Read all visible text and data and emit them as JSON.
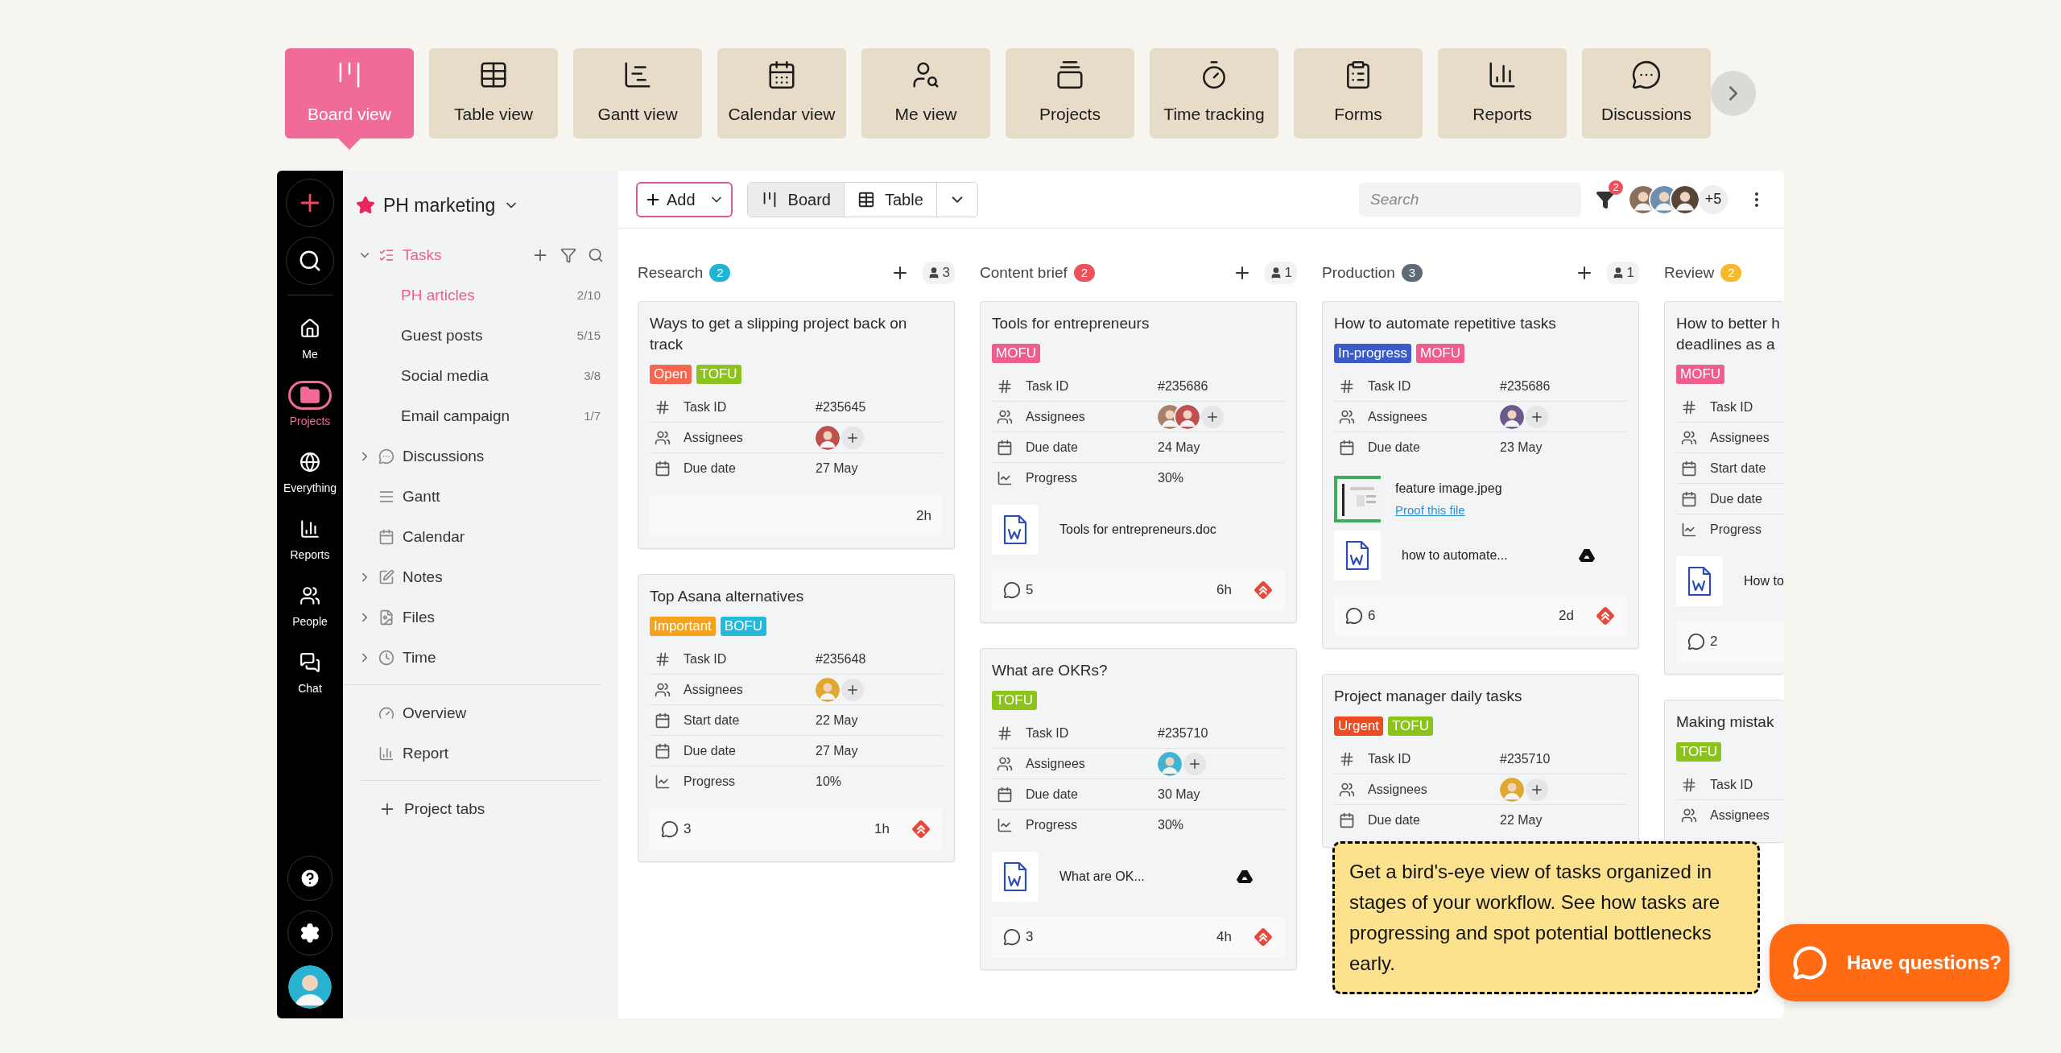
{
  "top_tabs": [
    {
      "label": "Board view",
      "selected": true
    },
    {
      "label": "Table view",
      "selected": false
    },
    {
      "label": "Gantt view",
      "selected": false
    },
    {
      "label": "Calendar view",
      "selected": false
    },
    {
      "label": "Me view",
      "selected": false
    },
    {
      "label": "Projects",
      "selected": false
    },
    {
      "label": "Time tracking",
      "selected": false
    },
    {
      "label": "Forms",
      "selected": false
    },
    {
      "label": "Reports",
      "selected": false
    },
    {
      "label": "Discussions",
      "selected": false
    }
  ],
  "rail": {
    "items": [
      {
        "label": "Me",
        "selected": false
      },
      {
        "label": "Projects",
        "selected": true
      },
      {
        "label": "Everything",
        "selected": false
      },
      {
        "label": "Reports",
        "selected": false
      },
      {
        "label": "People",
        "selected": false
      },
      {
        "label": "Chat",
        "selected": false
      }
    ]
  },
  "sidebar": {
    "project": "PH marketing",
    "groups": [
      [
        {
          "label": "Tasks",
          "expanded": true,
          "children": [
            {
              "label": "PH articles",
              "count": "2/10",
              "selected": true
            },
            {
              "label": "Guest posts",
              "count": "5/15",
              "selected": false
            },
            {
              "label": "Social media",
              "count": "3/8",
              "selected": false
            },
            {
              "label": "Email campaign",
              "count": "1/7",
              "selected": false
            }
          ]
        },
        {
          "label": "Discussions",
          "expanded": false
        },
        {
          "label": "Gantt"
        },
        {
          "label": "Calendar"
        },
        {
          "label": "Notes",
          "expanded": false
        },
        {
          "label": "Files",
          "expanded": false
        },
        {
          "label": "Time",
          "expanded": false
        }
      ],
      [
        {
          "label": "Overview"
        },
        {
          "label": "Report"
        }
      ]
    ],
    "add_tab": "Project tabs"
  },
  "toolbar": {
    "add": "Add",
    "views": [
      {
        "label": "Board",
        "selected": true
      },
      {
        "label": "Table",
        "selected": false
      }
    ],
    "search": {
      "placeholder": "Search"
    },
    "filter_count": "2",
    "members": [
      {
        "color": "#8a6f5c"
      },
      {
        "color": "#6d8fb0"
      },
      {
        "color": "#5a4636"
      }
    ],
    "more_members": "+5"
  },
  "columns": [
    {
      "title": "Research",
      "count": "2",
      "color": "#1fb5d6",
      "members": "3",
      "cards": [
        {
          "title": "Ways to get a slipping project back on track",
          "tags": [
            {
              "label": "Open",
              "color": "#f4664f"
            },
            {
              "label": "TOFU",
              "color": "#8cc21c"
            }
          ],
          "fields": [
            {
              "kind": "id",
              "label": "Task ID",
              "value": "#235645"
            },
            {
              "kind": "assignees",
              "label": "Assignees",
              "avatars": [
                {
                  "color": "#c0504d"
                }
              ]
            },
            {
              "kind": "date",
              "label": "Due date",
              "value": "27 May"
            }
          ],
          "footer": {
            "time": "2h"
          }
        },
        {
          "title": "Top Asana alternatives",
          "tags": [
            {
              "label": "Important",
              "color": "#f7a21b"
            },
            {
              "label": "BOFU",
              "color": "#27b7d8"
            }
          ],
          "fields": [
            {
              "kind": "id",
              "label": "Task ID",
              "value": "#235648"
            },
            {
              "kind": "assignees",
              "label": "Assignees",
              "avatars": [
                {
                  "color": "#e0a82e"
                }
              ]
            },
            {
              "kind": "date",
              "label": "Start date",
              "value": "22 May"
            },
            {
              "kind": "date",
              "label": "Due date",
              "value": "27 May"
            },
            {
              "kind": "progress",
              "label": "Progress",
              "value": "10%"
            }
          ],
          "footer": {
            "comments": "3",
            "time": "1h",
            "high_priority": true
          }
        }
      ]
    },
    {
      "title": "Content brief",
      "count": "2",
      "color": "#f0505a",
      "members": "1",
      "cards": [
        {
          "title": "Tools for entrepreneurs",
          "tags": [
            {
              "label": "MOFU",
              "color": "#ee5d8d"
            }
          ],
          "fields": [
            {
              "kind": "id",
              "label": "Task ID",
              "value": "#235686"
            },
            {
              "kind": "assignees",
              "label": "Assignees",
              "avatars": [
                {
                  "color": "#a98068"
                },
                {
                  "color": "#c0504d"
                }
              ]
            },
            {
              "kind": "date",
              "label": "Due date",
              "value": "24 May"
            },
            {
              "kind": "progress",
              "label": "Progress",
              "value": "30%"
            }
          ],
          "attachments": [
            {
              "kind": "doc",
              "name": "Tools for entrepreneurs.doc",
              "drive": false
            }
          ],
          "footer": {
            "comments": "5",
            "time": "6h",
            "high_priority": true
          }
        },
        {
          "title": "What are OKRs?",
          "tags": [
            {
              "label": "TOFU",
              "color": "#8cc21c"
            }
          ],
          "fields": [
            {
              "kind": "id",
              "label": "Task ID",
              "value": "#235710"
            },
            {
              "kind": "assignees",
              "label": "Assignees",
              "avatars": [
                {
                  "color": "#3fb3cf"
                }
              ]
            },
            {
              "kind": "date",
              "label": "Due date",
              "value": "30 May"
            },
            {
              "kind": "progress",
              "label": "Progress",
              "value": "30%"
            }
          ],
          "attachments": [
            {
              "kind": "doc",
              "name": "What are OK...",
              "drive": true
            }
          ],
          "footer": {
            "comments": "3",
            "time": "4h",
            "high_priority": true
          }
        }
      ]
    },
    {
      "title": "Production",
      "count": "3",
      "color": "#5d6b78",
      "members": "1",
      "cards": [
        {
          "title": "How to automate repetitive tasks",
          "tags": [
            {
              "label": "In-progress",
              "color": "#3a5bc7"
            },
            {
              "label": "MOFU",
              "color": "#ee5d8d"
            }
          ],
          "fields": [
            {
              "kind": "id",
              "label": "Task ID",
              "value": "#235686"
            },
            {
              "kind": "assignees",
              "label": "Assignees",
              "avatars": [
                {
                  "color": "#6b5a8e"
                }
              ]
            },
            {
              "kind": "date",
              "label": "Due date",
              "value": "23 May"
            }
          ],
          "attachments": [
            {
              "name": "feature image.jpeg",
              "link": "Proof this file"
            },
            {
              "kind": "doc",
              "name": "how to automate...",
              "drive": true
            }
          ],
          "footer": {
            "comments": "6",
            "time": "2d",
            "high_priority": true
          }
        },
        {
          "title": "Project manager daily tasks",
          "tags": [
            {
              "label": "Urgent",
              "color": "#ee4b23"
            },
            {
              "label": "TOFU",
              "color": "#8cc21c"
            }
          ],
          "fields": [
            {
              "kind": "id",
              "label": "Task ID",
              "value": "#235710"
            },
            {
              "kind": "assignees",
              "label": "Assignees",
              "avatars": [
                {
                  "color": "#e0a82e"
                }
              ]
            },
            {
              "kind": "date",
              "label": "Due date",
              "value": "22 May"
            }
          ]
        }
      ]
    },
    {
      "title": "Review",
      "count": "2",
      "color": "#f5b92c",
      "cards": [
        {
          "title": "How to better h\ndeadlines as a",
          "tags": [
            {
              "label": "MOFU",
              "color": "#ee5d8d"
            }
          ],
          "fields": [
            {
              "kind": "id",
              "label": "Task ID"
            },
            {
              "kind": "assignees",
              "label": "Assignees"
            },
            {
              "kind": "date",
              "label": "Start date"
            },
            {
              "kind": "date",
              "label": "Due date"
            },
            {
              "kind": "progress",
              "label": "Progress"
            }
          ],
          "attachments": [
            {
              "kind": "doc",
              "name": "How to",
              "drive": false
            }
          ],
          "footer": {
            "comments": "2"
          }
        },
        {
          "title": "Making mistak",
          "tags": [
            {
              "label": "TOFU",
              "color": "#8cc21c"
            }
          ],
          "fields": [
            {
              "kind": "id",
              "label": "Task ID"
            },
            {
              "kind": "assignees",
              "label": "Assignees"
            }
          ]
        }
      ]
    }
  ],
  "tip": "Get a bird's-eye view of tasks organized in stages of your workflow. See how tasks are progressing and spot potential bottlenecks early.",
  "help_button": "Have questions?"
}
